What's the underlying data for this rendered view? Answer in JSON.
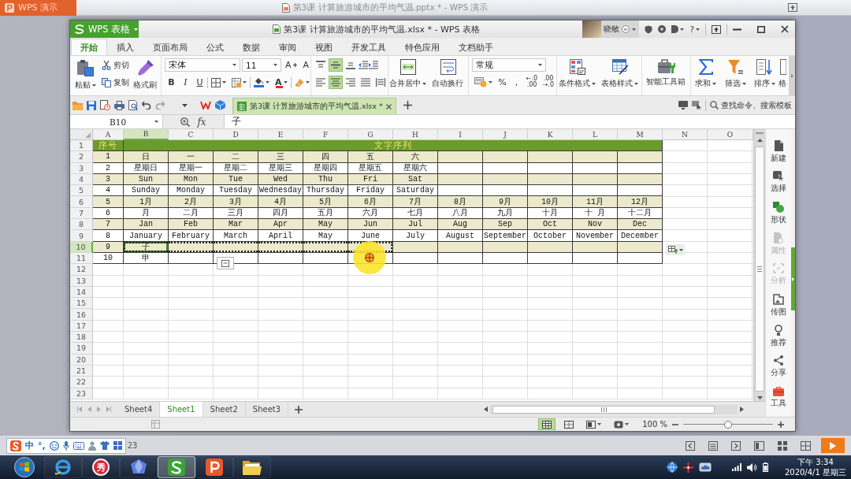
{
  "background_window": {
    "app_button": "WPS 演示",
    "title": "第3课 计算旅游城市的平均气温.pptx * - WPS 演示"
  },
  "window": {
    "app_menu": "WPS 表格",
    "title": "第3课 计算旅游城市的平均气温.xlsx * - WPS 表格",
    "user": "晓敏",
    "help": "?"
  },
  "ribbon_tabs": [
    {
      "label": "开始",
      "selected": true
    },
    {
      "label": "插入",
      "selected": false
    },
    {
      "label": "页面布局",
      "selected": false
    },
    {
      "label": "公式",
      "selected": false
    },
    {
      "label": "数据",
      "selected": false
    },
    {
      "label": "审阅",
      "selected": false
    },
    {
      "label": "视图",
      "selected": false
    },
    {
      "label": "开发工具",
      "selected": false
    },
    {
      "label": "特色应用",
      "selected": false
    },
    {
      "label": "文档助手",
      "selected": false
    }
  ],
  "ribbon": {
    "paste": "粘贴",
    "cut": "剪切",
    "copy": "复制",
    "format_painter": "格式刷",
    "font_name": "宋体",
    "font_size": "11",
    "size_buttons": [
      {
        "kind": "grow",
        "label": "A"
      },
      {
        "kind": "shrink",
        "label": "A"
      }
    ],
    "style_buttons": [
      {
        "kind": "bold",
        "label": "B"
      },
      {
        "kind": "italic",
        "label": "I"
      },
      {
        "kind": "underline",
        "label": "U"
      }
    ],
    "font_color": "A",
    "vertical_align": [
      {
        "kind": "top",
        "selected": false
      },
      {
        "kind": "middle",
        "selected": true
      },
      {
        "kind": "bottom",
        "selected": false
      }
    ],
    "horizontal_align": [
      {
        "kind": "left",
        "selected": false
      },
      {
        "kind": "center",
        "selected": true
      },
      {
        "kind": "right",
        "selected": false
      },
      {
        "kind": "justify",
        "selected": false
      },
      {
        "kind": "distributed",
        "selected": false
      }
    ],
    "merge": "合并居中",
    "wrap": "自动换行",
    "number_format": "常规",
    "percent": "%",
    "comma": ",",
    "decimal_buttons": [
      {
        "top": "←.0",
        "bottom": ".00"
      },
      {
        "top": ".00",
        "bottom": "→.0"
      }
    ],
    "large_buttons": [
      {
        "kind": "conditional",
        "label": "条件格式",
        "dropdown": true
      },
      {
        "kind": "table_style",
        "label": "表格样式",
        "dropdown": true
      },
      {
        "kind": "toolbox",
        "label": "智能工具箱",
        "dropdown": false
      },
      {
        "kind": "sum",
        "label": "求和",
        "dropdown": true
      },
      {
        "kind": "filter",
        "label": "筛选",
        "dropdown": true
      },
      {
        "kind": "sort",
        "label": "排序",
        "dropdown": true
      },
      {
        "kind": "format",
        "label": "格",
        "dropdown": false
      }
    ]
  },
  "doc_bar": {
    "tab": "第3课 计算旅游城市的平均气温.xlsx *",
    "search": {
      "placeholder": "查找命令、搜索模板"
    }
  },
  "formula_bar": {
    "cell": "B10",
    "fx": "fx",
    "value": "子"
  },
  "sheet": {
    "columns": [
      {
        "label": "A",
        "selected": false
      },
      {
        "label": "B",
        "selected": true
      },
      {
        "label": "C",
        "selected": false
      },
      {
        "label": "D",
        "selected": false
      },
      {
        "label": "E",
        "selected": false
      },
      {
        "label": "F",
        "selected": false
      },
      {
        "label": "G",
        "selected": false
      },
      {
        "label": "H",
        "selected": false
      },
      {
        "label": "I",
        "selected": false
      },
      {
        "label": "J",
        "selected": false
      },
      {
        "label": "K",
        "selected": false
      },
      {
        "label": "L",
        "selected": false
      },
      {
        "label": "M",
        "selected": false
      },
      {
        "label": "N",
        "selected": false
      },
      {
        "label": "O",
        "selected": false
      }
    ],
    "rows": [
      {
        "number": "1",
        "kind": "title",
        "selected": false,
        "cells": [
          "序号",
          "文字序列"
        ]
      },
      {
        "number": "2",
        "kind": "data",
        "shaded": true,
        "selected": false,
        "cells": [
          "1",
          "日",
          "一",
          "二",
          "三",
          "四",
          "五",
          "六"
        ]
      },
      {
        "number": "3",
        "kind": "data",
        "shaded": false,
        "selected": false,
        "cells": [
          "2",
          "星期日",
          "星期一",
          "星期二",
          "星期三",
          "星期四",
          "星期五",
          "星期六"
        ]
      },
      {
        "number": "4",
        "kind": "data",
        "shaded": true,
        "selected": false,
        "cells": [
          "3",
          "Sun",
          "Mon",
          "Tue",
          "Wed",
          "Thu",
          "Fri",
          "Sat"
        ]
      },
      {
        "number": "5",
        "kind": "data",
        "shaded": false,
        "selected": false,
        "cells": [
          "4",
          "Sunday",
          "Monday",
          "Tuesday",
          "Wednesday",
          "Thursday",
          "Friday",
          "Saturday"
        ]
      },
      {
        "number": "6",
        "kind": "data",
        "shaded": true,
        "selected": false,
        "cells": [
          "5",
          "1月",
          "2月",
          "3月",
          "4月",
          "5月",
          "6月",
          "7月",
          "8月",
          "9月",
          "10月",
          "11月",
          "12月"
        ]
      },
      {
        "number": "7",
        "kind": "data",
        "shaded": false,
        "selected": false,
        "cells": [
          "6",
          "月",
          "二月",
          "三月",
          "四月",
          "五月",
          "六月",
          "七月",
          "八月",
          "九月",
          "十月",
          "十 月",
          "十二月"
        ]
      },
      {
        "number": "8",
        "kind": "data",
        "shaded": true,
        "selected": false,
        "cells": [
          "7",
          "Jan",
          "Feb",
          "Mar",
          "Apr",
          "May",
          "Jun",
          "Jul",
          "Aug",
          "Sep",
          "Oct",
          "Nov",
          "Dec"
        ]
      },
      {
        "number": "9",
        "kind": "data",
        "shaded": false,
        "selected": false,
        "cells": [
          "8",
          "January",
          "February",
          "March",
          "April",
          "May",
          "June",
          "July",
          "August",
          "September",
          "October",
          "November",
          "December"
        ]
      },
      {
        "number": "10",
        "kind": "data",
        "shaded": true,
        "selected": true,
        "cells": [
          "9",
          "子"
        ],
        "outlined_cells": [
          false,
          true,
          true,
          true,
          true,
          true,
          true
        ]
      },
      {
        "number": "11",
        "kind": "data",
        "shaded": false,
        "selected": false,
        "cells": [
          "10",
          "甲"
        ]
      },
      {
        "number": "12",
        "kind": "blank",
        "selected": false
      },
      {
        "number": "13",
        "kind": "blank",
        "selected": false
      },
      {
        "number": "14",
        "kind": "blank",
        "selected": false
      },
      {
        "number": "15",
        "kind": "blank",
        "selected": false
      },
      {
        "number": "16",
        "kind": "blank",
        "selected": false
      },
      {
        "number": "17",
        "kind": "blank",
        "selected": false
      },
      {
        "number": "18",
        "kind": "blank",
        "selected": false
      },
      {
        "number": "19",
        "kind": "blank",
        "selected": false
      },
      {
        "number": "20",
        "kind": "blank",
        "selected": false
      },
      {
        "number": "21",
        "kind": "blank",
        "selected": false
      },
      {
        "number": "22",
        "kind": "blank",
        "selected": false
      },
      {
        "number": "23",
        "kind": "blank",
        "selected": false
      }
    ]
  },
  "side_panel": [
    {
      "kind": "new",
      "label": "新建",
      "disabled": false
    },
    {
      "kind": "select",
      "label": "选择",
      "disabled": false
    },
    {
      "kind": "shape",
      "label": "形状",
      "disabled": false
    },
    {
      "kind": "properties",
      "label": "属性",
      "disabled": true
    },
    {
      "kind": "analysis",
      "label": "分析",
      "disabled": true
    },
    {
      "kind": "image",
      "label": "传图",
      "disabled": false
    },
    {
      "kind": "recommend",
      "label": "推荐",
      "disabled": false
    },
    {
      "kind": "share",
      "label": "分享",
      "disabled": false
    },
    {
      "kind": "tools",
      "label": "工具",
      "disabled": false
    }
  ],
  "sheet_tabs": [
    {
      "label": "Sheet4",
      "selected": false
    },
    {
      "label": "Sheet1",
      "selected": true
    },
    {
      "label": "Sheet2",
      "selected": false
    },
    {
      "label": "Sheet3",
      "selected": false
    }
  ],
  "status_bar": {
    "view_buttons": [
      {
        "kind": "normal",
        "selected": true
      },
      {
        "kind": "page",
        "selected": false
      },
      {
        "kind": "reading",
        "selected": false
      },
      {
        "kind": "eye",
        "selected": false
      }
    ],
    "zoom": {
      "label": "100 %",
      "level": 0.5
    }
  },
  "ime_bar": {
    "mode": "中",
    "punctuation": "°,"
  },
  "background_status": {
    "text": "23"
  },
  "taskbar": {
    "apps": [
      {
        "kind": "browser",
        "selected": false
      },
      {
        "kind": "badge",
        "label": "秀",
        "selected": false
      },
      {
        "kind": "gem",
        "selected": false
      },
      {
        "kind": "spreadsheet",
        "selected": true
      },
      {
        "kind": "presentation",
        "selected": false
      },
      {
        "kind": "folder",
        "selected": false
      }
    ],
    "time": "下午 3:34",
    "date": "2020/4/1 星期三"
  }
}
